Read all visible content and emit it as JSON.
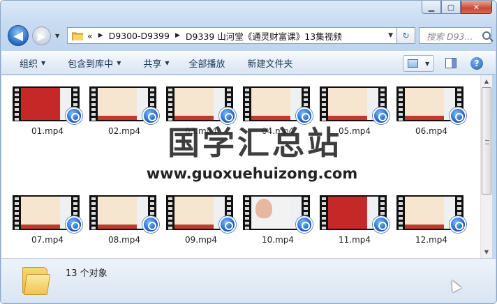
{
  "window": {
    "minimize_glyph": "▁",
    "maximize_glyph": "▢",
    "close_glyph": "✕"
  },
  "navigation": {
    "back_glyph": "◀",
    "forward_glyph": "▶",
    "history_glyph": "▼"
  },
  "address": {
    "overflow": "«",
    "breadcrumbs": [
      "D9300-D9399",
      "D9339 山河堂《通灵财富课》13集视频"
    ],
    "separator": "▶",
    "dropdown_glyph": "▼",
    "refresh_glyph": "↻"
  },
  "search": {
    "placeholder": "搜索 D93..."
  },
  "toolbar": {
    "items": [
      {
        "label": "组织",
        "dropdown": true
      },
      {
        "label": "包含到库中",
        "dropdown": true
      },
      {
        "label": "共享",
        "dropdown": true
      },
      {
        "label": "全部播放",
        "dropdown": false
      },
      {
        "label": "新建文件夹",
        "dropdown": false
      }
    ],
    "dropdown_glyph": "▼",
    "help_glyph": "?"
  },
  "files": [
    {
      "name": "01.mp4",
      "thumb": "red"
    },
    {
      "name": "02.mp4",
      "thumb": "slide"
    },
    {
      "name": "03.mp4",
      "thumb": "slide"
    },
    {
      "name": "04.mp4",
      "thumb": "slide"
    },
    {
      "name": "05.mp4",
      "thumb": "slide"
    },
    {
      "name": "06.mp4",
      "thumb": "slide"
    },
    {
      "name": "07.mp4",
      "thumb": "slide"
    },
    {
      "name": "08.mp4",
      "thumb": "slide"
    },
    {
      "name": "09.mp4",
      "thumb": "slide"
    },
    {
      "name": "10.mp4",
      "thumb": "photo"
    },
    {
      "name": "11.mp4",
      "thumb": "red"
    },
    {
      "name": "12.mp4",
      "thumb": "slide"
    }
  ],
  "watermark": {
    "title": "国学汇总站",
    "url": "www.guoxuehuizong.com"
  },
  "details": {
    "count_text": "13 个对象"
  },
  "scrollbar": {
    "up_glyph": "▲",
    "down_glyph": "▼"
  }
}
